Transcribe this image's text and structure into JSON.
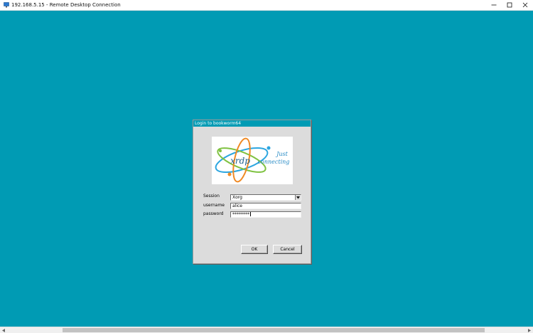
{
  "window": {
    "title": "192.168.5.15 - Remote Desktop Connection",
    "controls": [
      "minimize-icon",
      "maximize-icon",
      "close-icon"
    ]
  },
  "remote_desktop": {
    "background_color": "#009bb4"
  },
  "dialog": {
    "title": "Login to bookworm64",
    "logo": {
      "brand_text": "xrdp",
      "tagline_line1": "Just",
      "tagline_line2": "connecting"
    },
    "session": {
      "label": "Session",
      "value": "Xorg"
    },
    "username": {
      "label": "username",
      "value": "alice"
    },
    "password": {
      "label": "password",
      "masked_value": "********"
    },
    "buttons": {
      "ok_label": "OK",
      "cancel_label": "Cancel"
    }
  },
  "scrollbar": {
    "orientation": "horizontal"
  }
}
